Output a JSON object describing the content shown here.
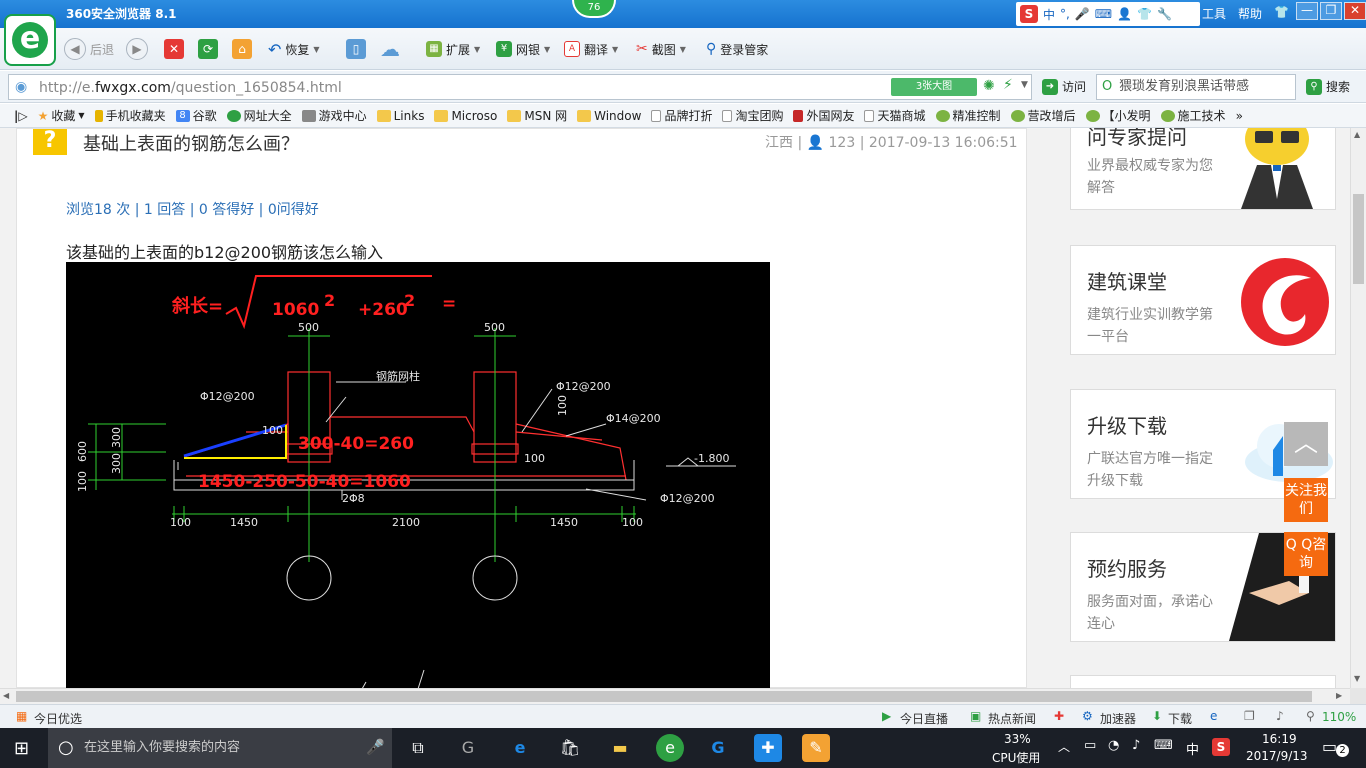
{
  "browser": {
    "title": "360安全浏览器 8.1",
    "badge": "76",
    "ime": {
      "lang": "中",
      "punct": "°,"
    },
    "menu": [
      "工具",
      "帮助"
    ],
    "window_buttons": [
      "—",
      "❐",
      "✕"
    ]
  },
  "toolbar": {
    "back": "后退",
    "restore": "恢复",
    "extend": "扩展",
    "netbank": "网银",
    "translate": "翻译",
    "screenshot": "截图",
    "login_manager": "登录管家"
  },
  "address": {
    "url_prefix": "http://e.",
    "url_domain": "fwxgx.com",
    "url_path": "/question_1650854.html",
    "big_image": "3张大图",
    "visit": "访问",
    "search_value": "猥琐发育别浪黑话带感",
    "search_button": "搜索"
  },
  "favorites": [
    "收藏",
    "手机收藏夹",
    "谷歌",
    "网址大全",
    "游戏中心",
    "Links",
    "Microso",
    "MSN 网",
    "Window",
    "品牌打折",
    "淘宝团购",
    "外国网友",
    "天猫商城",
    "精准控制",
    "营改增后",
    "【小发明",
    "施工技术"
  ],
  "question": {
    "title": "基础上表面的钢筋怎么画？",
    "region": "江西",
    "user_id": "123",
    "date": "2017-09-13 16:06:51",
    "stats": "浏览18 次 | 1 回答 | 0 答得好 | 0问得好",
    "body": "该基础的上表面的b12@200钢筋该怎么输入"
  },
  "cad": {
    "formula_label": "斜长=",
    "formula_a": "1060",
    "formula_b": "+260",
    "exp": "2",
    "equals": "=",
    "calc_height": "300-40=260",
    "calc_length": "1450-250-50-40=1060",
    "dim_500a": "500",
    "dim_500b": "500",
    "label_column": "钢筋网柱",
    "label_phi12_left": "Φ12@200",
    "label_phi12_right": "Φ12@200",
    "label_phi14": "Φ14@200",
    "label_phi12_bottom": "Φ12@200",
    "label_2phi8": "2Φ8",
    "elev": "-1.800",
    "v600": "600",
    "v300a": "300",
    "v300b": "300",
    "v100": "100",
    "d100a": "100",
    "d100b": "100",
    "d100c": "100",
    "d100d": "100",
    "d100e": "100",
    "d1450a": "1450",
    "d2100": "2100",
    "d1450b": "1450"
  },
  "sidebar": [
    {
      "title": "问专家提问",
      "desc": "业界最权威专家为您解答"
    },
    {
      "title": "建筑课堂",
      "desc": "建筑行业实训教学第一平台"
    },
    {
      "title": "升级下载",
      "desc": "广联达官方唯一指定升级下载"
    },
    {
      "title": "预约服务",
      "desc": "服务面对面，承诺心连心"
    }
  ],
  "float": {
    "up": "︿",
    "follow": "关注我们",
    "qq": "Q Q咨询"
  },
  "status": {
    "left": "今日优选",
    "live": "今日直播",
    "hotnews": "热点新闻",
    "accelerator": "加速器",
    "download": "下载",
    "zoom": "110%"
  },
  "taskbar": {
    "search_placeholder": "在这里输入你要搜索的内容",
    "cpu_percent": "33%",
    "cpu_label": "CPU使用",
    "lang": "中",
    "time": "16:19",
    "date": "2017/9/13",
    "notif": "2"
  }
}
